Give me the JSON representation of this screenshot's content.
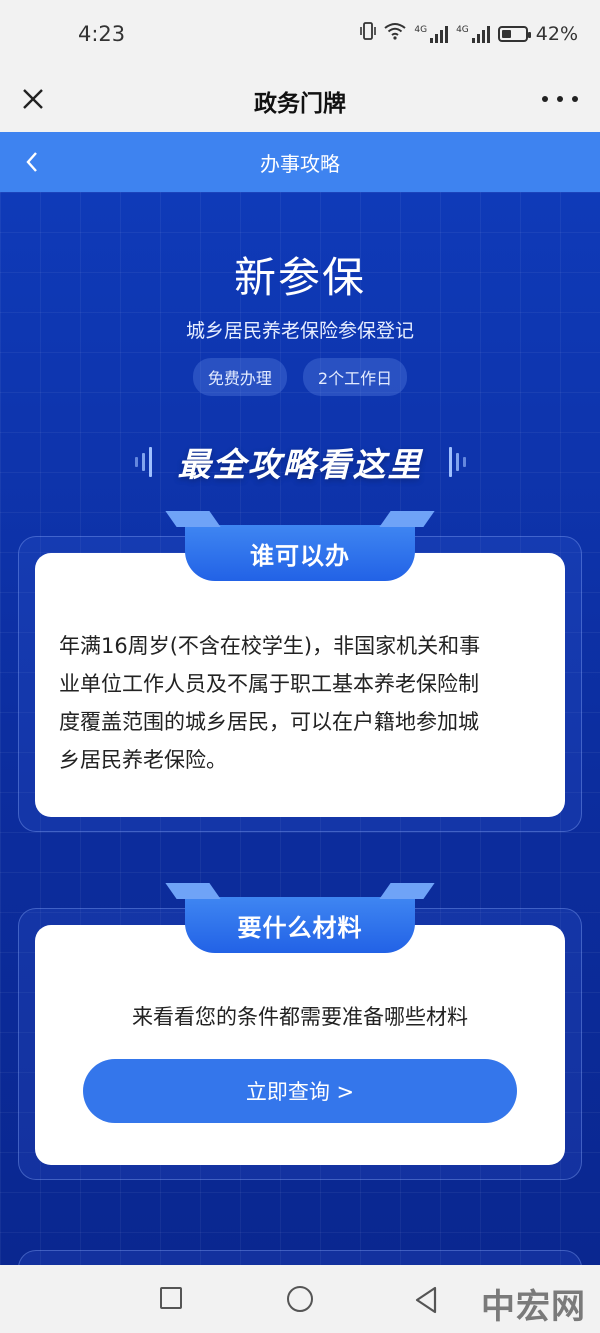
{
  "status_bar": {
    "time": "4:23",
    "network_1": "4G",
    "network_2": "4G",
    "battery_text": "42%",
    "battery_level": 0.42
  },
  "title_bar": {
    "title": "政务门牌"
  },
  "nav_bar": {
    "title": "办事攻略"
  },
  "hero": {
    "title": "新参保",
    "subtitle": "城乡居民养老保险参保登记",
    "tags": [
      "免费办理",
      "2个工作日"
    ],
    "slogan": "最全攻略看这里"
  },
  "who_card": {
    "tab_label": "谁可以办",
    "lines": [
      "年满16周岁(不含在校学生)，非国家机关和事",
      "业单位工作人员及不属于职工基本养老保险制",
      "度覆盖范围的城乡居民，可以在户籍地参加城",
      "乡居民养老保险。"
    ]
  },
  "materials_card": {
    "tab_label": "要什么材料",
    "description": "来看看您的条件都需要准备哪些材料",
    "button_label": "立即查询 >"
  },
  "watermark": "中宏网",
  "colors": {
    "header_blue": "#3e83f0",
    "page_bg": "#0d2fa8",
    "button_blue": "#3476eb"
  }
}
